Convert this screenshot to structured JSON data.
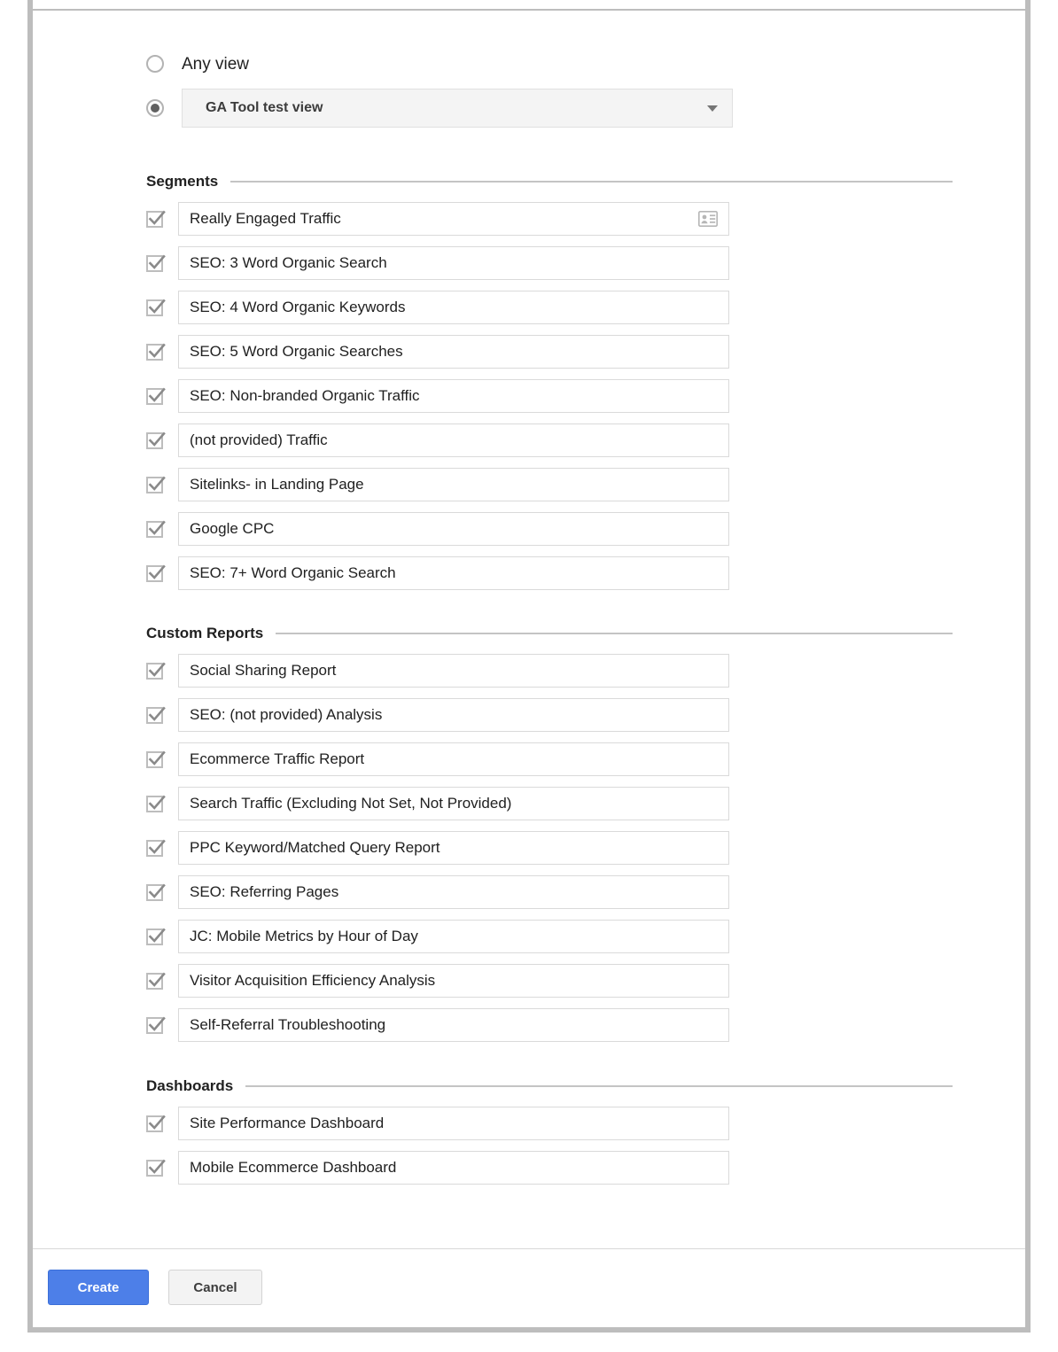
{
  "scope": {
    "any_view_label": "Any view",
    "any_view_selected": false,
    "specific_view_selected": true,
    "selected_view": "GA Tool test view"
  },
  "sections": [
    {
      "title": "Segments",
      "items": [
        {
          "label": "Really Engaged Traffic",
          "checked": true,
          "icon": "contact-card-icon"
        },
        {
          "label": "SEO: 3 Word Organic Search",
          "checked": true,
          "icon": null
        },
        {
          "label": "SEO: 4 Word Organic Keywords",
          "checked": true,
          "icon": null
        },
        {
          "label": "SEO: 5 Word Organic Searches",
          "checked": true,
          "icon": null
        },
        {
          "label": "SEO: Non-branded Organic Traffic",
          "checked": true,
          "icon": null
        },
        {
          "label": "(not provided) Traffic",
          "checked": true,
          "icon": null
        },
        {
          "label": "Sitelinks- in Landing Page",
          "checked": true,
          "icon": null
        },
        {
          "label": "Google CPC",
          "checked": true,
          "icon": null
        },
        {
          "label": "SEO: 7+ Word Organic Search",
          "checked": true,
          "icon": null
        }
      ]
    },
    {
      "title": "Custom Reports",
      "items": [
        {
          "label": "Social Sharing Report",
          "checked": true,
          "icon": null
        },
        {
          "label": "SEO: (not provided) Analysis",
          "checked": true,
          "icon": null
        },
        {
          "label": "Ecommerce Traffic Report",
          "checked": true,
          "icon": null
        },
        {
          "label": "Search Traffic (Excluding Not Set, Not Provided)",
          "checked": true,
          "icon": null
        },
        {
          "label": "PPC Keyword/Matched Query Report",
          "checked": true,
          "icon": null
        },
        {
          "label": "SEO: Referring Pages",
          "checked": true,
          "icon": null
        },
        {
          "label": "JC: Mobile Metrics by Hour of Day",
          "checked": true,
          "icon": null
        },
        {
          "label": "Visitor Acquisition Efficiency Analysis",
          "checked": true,
          "icon": null
        },
        {
          "label": "Self-Referral Troubleshooting",
          "checked": true,
          "icon": null
        }
      ]
    },
    {
      "title": "Dashboards",
      "items": [
        {
          "label": "Site Performance Dashboard",
          "checked": true,
          "icon": null
        },
        {
          "label": "Mobile Ecommerce Dashboard",
          "checked": true,
          "icon": null
        }
      ]
    }
  ],
  "footer": {
    "create_label": "Create",
    "cancel_label": "Cancel"
  },
  "colors": {
    "primary_button": "#4d7fe8",
    "frame_border": "#bdbdbd",
    "field_border": "#dadada",
    "checkbox_gray": "#bdbdbd"
  }
}
